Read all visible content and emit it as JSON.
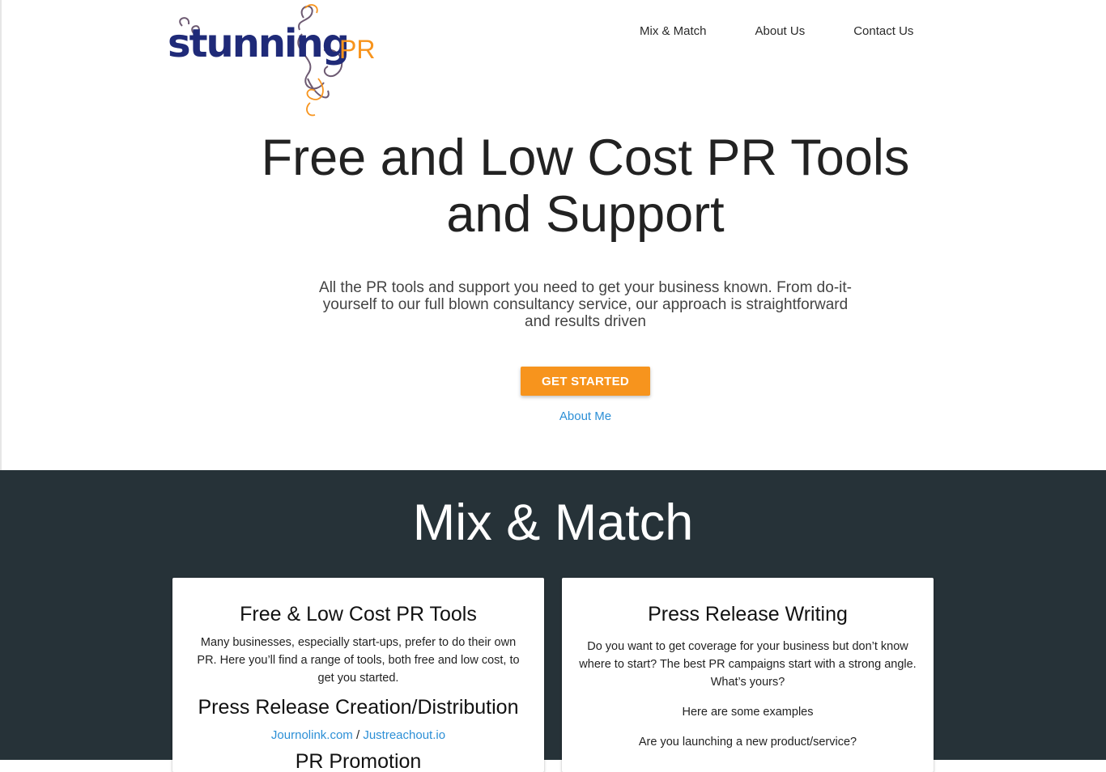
{
  "brand": {
    "logo_text_main": "stunning",
    "logo_text_accent": "PR",
    "colors": {
      "navy": "#1f2a78",
      "orange": "#f7941d",
      "swirl": "#6d5a72"
    }
  },
  "nav": {
    "items": [
      {
        "label": "Mix & Match"
      },
      {
        "label": "About Us"
      },
      {
        "label": "Contact Us"
      }
    ]
  },
  "hero": {
    "title_line1": "Free and Low Cost PR Tools",
    "title_line2": "and Support",
    "subtitle": "All the PR tools and support you need to get your business known. From do-it-yourself to our full blown consultancy service, our approach is straightforward and results driven",
    "cta_label": "GET STARTED",
    "about_link": "About Me"
  },
  "mix": {
    "title": "Mix & Match",
    "background": "#263238",
    "card_left": {
      "title": "Free & Low Cost PR Tools",
      "description": "Many businesses, especially start-ups, prefer to do their own PR. Here you’ll find a range of tools, both free and low cost, to get you started.",
      "subtitle": "Press Release Creation/Distribution",
      "link1": "Journolink.com",
      "separator": " / ",
      "link2": "Justreachout.io",
      "next_heading": "PR Promotion"
    },
    "card_right": {
      "title": "Press Release Writing",
      "description": "Do you want to get coverage for your business but don’t know where to start? The best PR campaigns start with a strong angle. What’s yours?",
      "examples_intro": "Here are some examples",
      "question": "Are you launching a new product/service?"
    }
  },
  "accent_link_color": "#2c8fd6"
}
